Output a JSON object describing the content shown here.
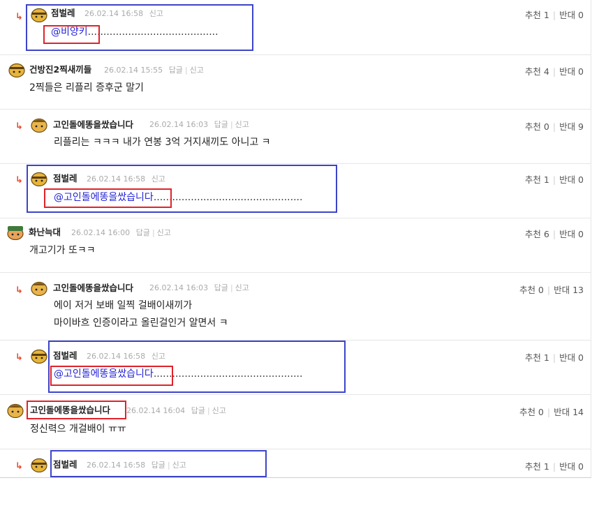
{
  "comments": [
    {
      "reply": true,
      "nick": "점벌레",
      "time": "26.02.14 16:58",
      "actions": [
        "신고"
      ],
      "body": "@비양키",
      "mention": true,
      "dots": "..........................................",
      "up": "추천 1",
      "down": "반대 0"
    },
    {
      "reply": false,
      "nick": "건방진2찍새끼들",
      "time": "26.02.14 15:55",
      "actions": [
        "답글",
        "신고"
      ],
      "body": "2찍들은 리플리 증후군 말기",
      "up": "추천 4",
      "down": "반대 0"
    },
    {
      "reply": true,
      "nick": "고인돌에똥을쌌습니다",
      "time": "26.02.14 16:03",
      "actions": [
        "답글",
        "신고"
      ],
      "body": "리플리는 ㅋㅋㅋ 내가 연봉 3억 거지새끼도 아니고 ㅋ",
      "up": "추천 0",
      "down": "반대 9"
    },
    {
      "reply": true,
      "nick": "점벌레",
      "time": "26.02.14 16:58",
      "actions": [
        "신고"
      ],
      "body": "@고인돌에똥을쌌습니다",
      "mention": true,
      "dots": "................................................",
      "up": "추천 1",
      "down": "반대 0"
    },
    {
      "reply": false,
      "nick": "화난늑대",
      "time": "26.02.14 16:00",
      "actions": [
        "답글",
        "신고"
      ],
      "body": "개고기가 또ㅋㅋ",
      "up": "추천 6",
      "down": "반대 0"
    },
    {
      "reply": true,
      "nick": "고인돌에똥을쌌습니다",
      "time": "26.02.14 16:03",
      "actions": [
        "답글",
        "신고"
      ],
      "body": "에이 저거 보배 일찍 걸배이새끼가",
      "body2": "마이바흐 인증이라고 올린걸인거 알면서 ㅋ",
      "up": "추천 0",
      "down": "반대 13"
    },
    {
      "reply": true,
      "nick": "점벌레",
      "time": "26.02.14 16:58",
      "actions": [
        "신고"
      ],
      "body": "@고인돌에똥을쌌습니다",
      "mention": true,
      "dots": "................................................",
      "up": "추천 1",
      "down": "반대 0"
    },
    {
      "reply": false,
      "nick": "고인돌에똥을쌌습니다",
      "time": "26.02.14 16:04",
      "actions": [
        "답글",
        "신고"
      ],
      "body": "정신력으 개걸배이 ㅠㅠ",
      "up": "추천 0",
      "down": "반대 14"
    },
    {
      "reply": true,
      "nick": "점벌레",
      "time": "26.02.14 16:58",
      "actions": [
        "답글",
        "신고"
      ],
      "body": "",
      "up": "추천 1",
      "down": "반대 0"
    }
  ],
  "reply_arrow": "↳",
  "colors": {
    "arrow": "#e8472b",
    "mention": "#2323d6",
    "highlight_blue": "#3c44c8",
    "highlight_red": "#e0222a"
  }
}
